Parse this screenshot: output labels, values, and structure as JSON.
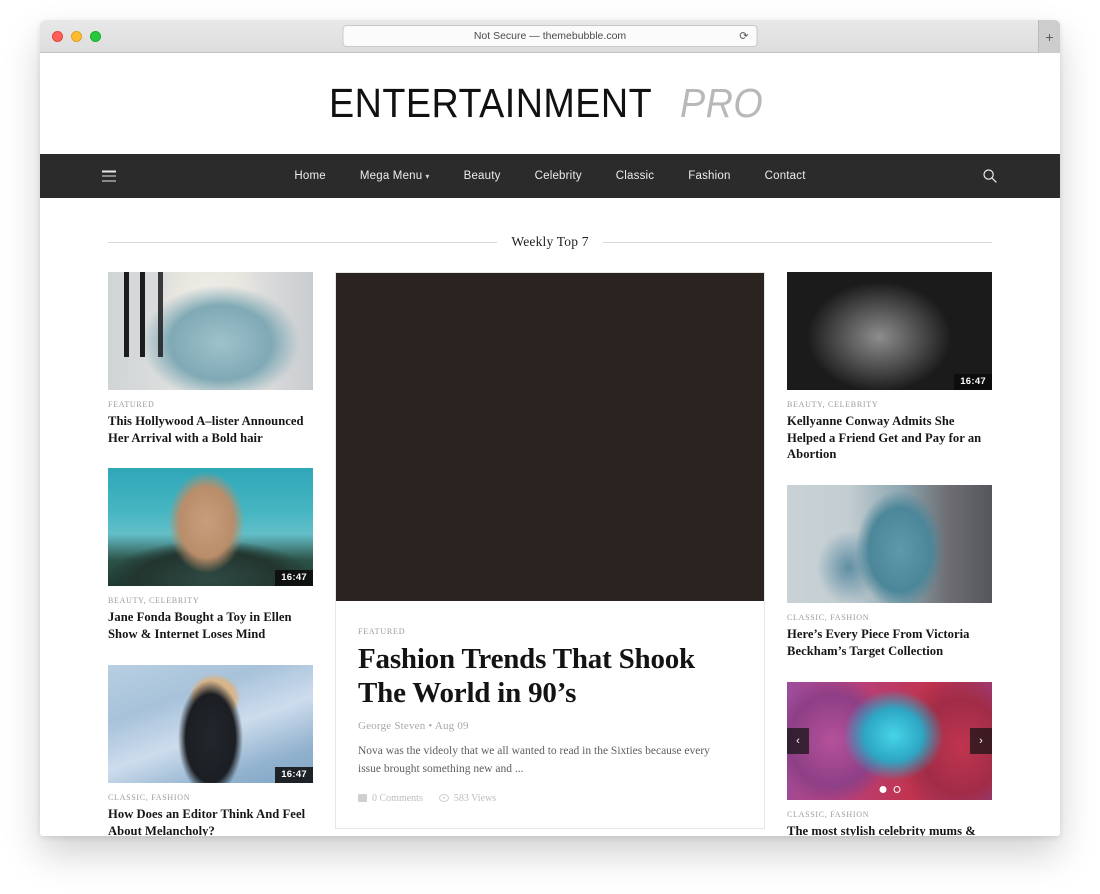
{
  "browser": {
    "url_text": "Not Secure — themebubble.com",
    "reload_icon": "reload-icon",
    "new_tab_label": "+"
  },
  "site": {
    "logo": {
      "main": "ENTERTAINMENT",
      "sub": "PRO"
    },
    "nav": {
      "hamburger_icon": "hamburger-icon",
      "search_icon": "search-icon",
      "items": [
        {
          "label": "Home",
          "has_caret": false
        },
        {
          "label": "Mega Menu",
          "has_caret": true
        },
        {
          "label": "Beauty",
          "has_caret": false
        },
        {
          "label": "Celebrity",
          "has_caret": false
        },
        {
          "label": "Classic",
          "has_caret": false
        },
        {
          "label": "Fashion",
          "has_caret": false
        },
        {
          "label": "Contact",
          "has_caret": false
        }
      ]
    },
    "section": {
      "title": "Weekly Top 7"
    },
    "left_cards": [
      {
        "category": "FEATURED",
        "title": "This Hollywood A–lister Announced Her Arrival with a Bold hair",
        "duration": "",
        "image": "woman-white-top-blue-skirt"
      },
      {
        "category": "BEAUTY, CELEBRITY",
        "title": "Jane Fonda Bought a Toy in Ellen Show & Internet Loses Mind",
        "duration": "16:47",
        "image": "woman-outdoors-teal-sky"
      },
      {
        "category": "CLASSIC, FASHION",
        "title": "How Does an Editor Think And Feel About Melancholy?",
        "duration": "16:47",
        "image": "blonde-woman-blue-backdrop"
      }
    ],
    "right_cards": [
      {
        "category": "BEAUTY, CELEBRITY",
        "title": "Kellyanne Conway Admits She Helped a Friend Get and Pay for an Abortion",
        "duration": "16:47",
        "image": "bw-back-portrait"
      },
      {
        "category": "CLASSIC, FASHION",
        "title": "Here’s Every Piece From Victoria Beckham’s Target Collection",
        "duration": "",
        "image": "seated-ripped-jeans"
      },
      {
        "category": "CLASSIC, FASHION",
        "title": "The most stylish celebrity mums & daughters",
        "duration": "",
        "image": "pink-blue-portrait",
        "carousel": {
          "prev_icon": "chevron-left-icon",
          "next_icon": "chevron-right-icon",
          "prev_label": "‹",
          "next_label": "›",
          "dots": 2,
          "active_dot": 0
        }
      }
    ],
    "feature": {
      "category": "FEATURED",
      "title": "Fashion Trends That Shook The World in 90’s",
      "author": "George Steven",
      "date": "Aug 09",
      "byline_separator": "•",
      "excerpt": "Nova was the videoly that we all wanted to read in the Sixties because every issue brought something new and ...",
      "comments": "0 Comments",
      "views": "583 Views",
      "image": "woman-leather-jacket"
    }
  }
}
